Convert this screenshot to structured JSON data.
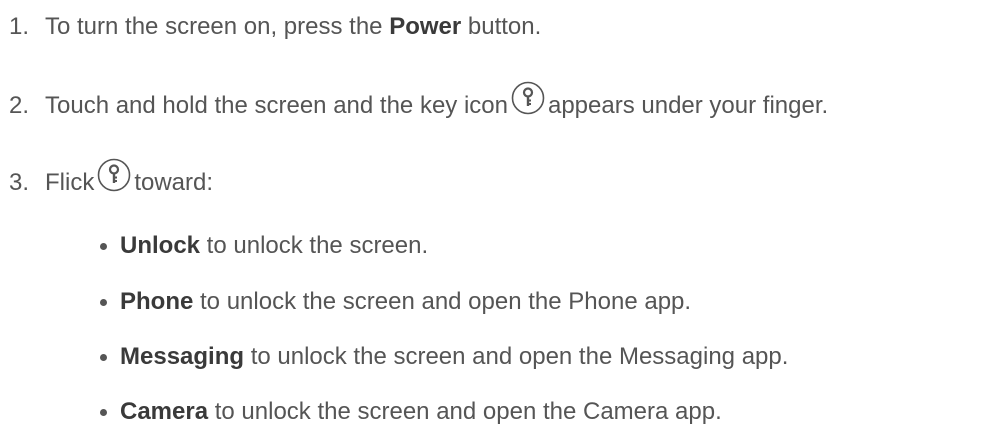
{
  "steps": [
    {
      "number": "1.",
      "before": "To turn the screen on, press the ",
      "bold": "Power",
      "after": " button."
    },
    {
      "number": "2.",
      "before": "Touch and hold the screen and the key icon",
      "after": "appears under your finger."
    },
    {
      "number": "3.",
      "before": "Flick",
      "after": "toward:"
    }
  ],
  "bullets": [
    {
      "bold": "Unlock",
      "rest": " to unlock the screen."
    },
    {
      "bold": "Phone",
      "rest": " to unlock the screen and open the Phone app."
    },
    {
      "bold": "Messaging",
      "rest": " to unlock the screen and open the Messaging app."
    },
    {
      "bold": "Camera",
      "rest": " to unlock the screen and open the Camera app."
    }
  ],
  "icons": {
    "key": "key-icon"
  }
}
